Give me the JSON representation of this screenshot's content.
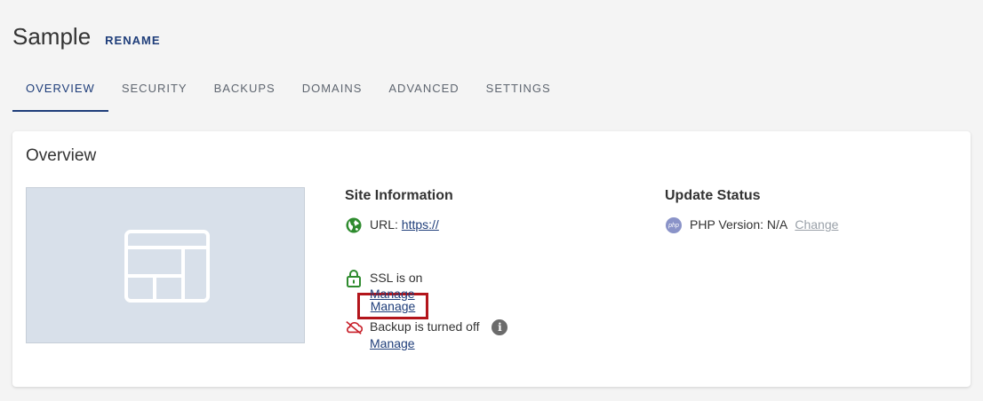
{
  "header": {
    "title": "Sample",
    "rename_label": "RENAME"
  },
  "tabs": [
    {
      "label": "OVERVIEW",
      "active": true
    },
    {
      "label": "SECURITY"
    },
    {
      "label": "BACKUPS"
    },
    {
      "label": "DOMAINS"
    },
    {
      "label": "ADVANCED"
    },
    {
      "label": "SETTINGS"
    }
  ],
  "overview": {
    "title": "Overview",
    "site_info": {
      "heading": "Site Information",
      "url_label": "URL:",
      "url_value": "https://",
      "url_manage": "Manage",
      "ssl_text": "SSL is on",
      "ssl_manage": "Manage",
      "backup_text": "Backup is turned off",
      "backup_manage": "Manage",
      "info_glyph": "i"
    },
    "update_status": {
      "heading": "Update Status",
      "php_badge": "php",
      "php_text": "PHP Version: N/A",
      "change_label": "Change"
    }
  },
  "colors": {
    "accent": "#1f3e7a",
    "highlight_box": "#b3151b",
    "globe_green": "#2e8b2e",
    "lock_green": "#2e8b2e",
    "cloud_red": "#c8202a"
  },
  "icons": [
    "layout-placeholder-icon",
    "globe-icon",
    "lock-icon",
    "cloud-off-icon",
    "info-icon",
    "php-icon"
  ]
}
